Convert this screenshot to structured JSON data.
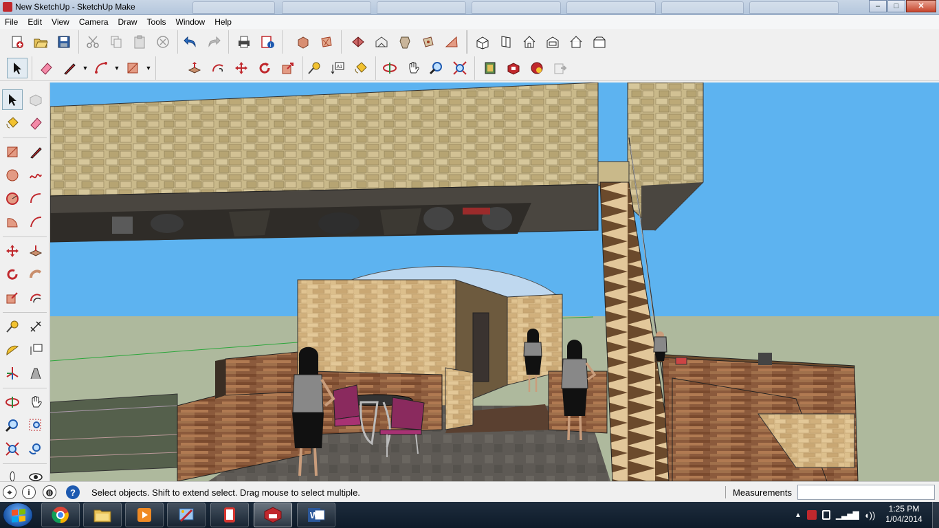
{
  "window": {
    "title": "New SketchUp - SketchUp Make",
    "controls": {
      "minimize": "–",
      "maximize": "□",
      "close": "✕"
    }
  },
  "menu": [
    "File",
    "Edit",
    "View",
    "Camera",
    "Draw",
    "Tools",
    "Window",
    "Help"
  ],
  "toolbar_row1_icons": [
    "new-icon",
    "open-icon",
    "save-icon",
    "cut-icon",
    "copy-icon",
    "paste-icon",
    "erase-icon",
    "undo-icon",
    "redo-icon",
    "print-icon",
    "model-info-icon",
    "iso-view-icon",
    "top-view-icon",
    "front-view-icon",
    "right-view-icon",
    "back-view-icon",
    "left-view-icon",
    "bottom-view-icon",
    "xray-icon",
    "wireframe-icon",
    "hidden-line-icon",
    "shaded-icon",
    "shaded-textures-icon",
    "monochrome-icon"
  ],
  "toolbar_row2_icons": [
    "select-icon",
    "eraser-icon",
    "line-icon",
    "arc-icon",
    "rectangle-icon",
    "push-pull-icon",
    "follow-me-icon",
    "move-icon",
    "rotate-icon",
    "scale-icon",
    "tape-measure-icon",
    "text-icon",
    "paint-bucket-icon",
    "orbit-icon",
    "pan-icon",
    "zoom-icon",
    "zoom-extents-icon",
    "3d-warehouse-icon",
    "extension-warehouse-icon",
    "layout-icon",
    "send-to-layout-icon"
  ],
  "status": {
    "message": "Select objects. Shift to extend select. Drag mouse to select multiple.",
    "measurements_label": "Measurements",
    "measurements_value": ""
  },
  "taskbar": {
    "apps": [
      "chrome-icon",
      "file-explorer-icon",
      "media-player-icon",
      "paint-icon",
      "phone-app-icon",
      "sketchup-icon",
      "word-icon"
    ],
    "word_letter": "W",
    "time": "1:25 PM",
    "date": "1/04/2014"
  },
  "colors": {
    "sky": "#5db3f0",
    "ground": "#aeb99d",
    "stone": "#c9b98a",
    "wood": "#8b5a3c",
    "accent_red": "#c0282d"
  }
}
